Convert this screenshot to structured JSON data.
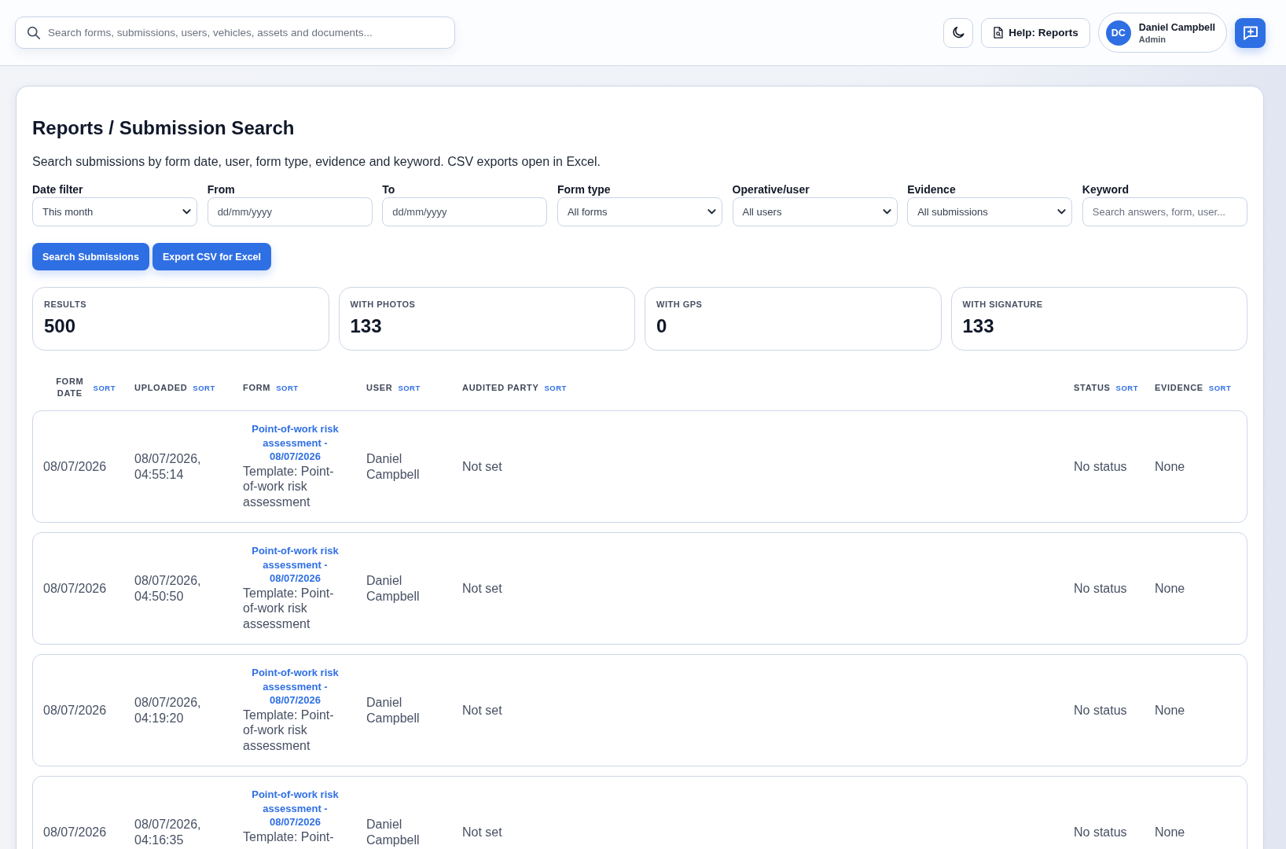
{
  "top_bar": {
    "search": {
      "placeholder": "Search forms, submissions, users, vehicles, assets and documents..."
    },
    "help_button": "Help: Reports",
    "user": {
      "initials": "DC",
      "name": "Daniel Campbell",
      "role": "Admin"
    }
  },
  "page": {
    "title": "Reports / Submission Search",
    "description": "Search submissions by form date, user, form type, evidence and keyword. CSV exports open in Excel."
  },
  "filters": [
    {
      "kind": "select",
      "label": "Date filter",
      "value": "This month"
    },
    {
      "kind": "date",
      "label": "From",
      "placeholder": "dd/mm/yyyy"
    },
    {
      "kind": "date",
      "label": "To",
      "placeholder": "dd/mm/yyyy"
    },
    {
      "kind": "select",
      "label": "Form type",
      "value": "All forms"
    },
    {
      "kind": "select",
      "label": "Operative/user",
      "value": "All users"
    },
    {
      "kind": "select",
      "label": "Evidence",
      "value": "All submissions"
    },
    {
      "kind": "text",
      "label": "Keyword",
      "placeholder": "Search answers, form, user..."
    }
  ],
  "actions": [
    "Search Submissions",
    "Export CSV for Excel"
  ],
  "stats": [
    {
      "label": "RESULTS",
      "value": "500"
    },
    {
      "label": "WITH PHOTOS",
      "value": "133"
    },
    {
      "label": "WITH GPS",
      "value": "0"
    },
    {
      "label": "WITH SIGNATURE",
      "value": "133"
    }
  ],
  "table": {
    "columns": [
      {
        "label": "FORM DATE",
        "sort": "SORT"
      },
      {
        "label": "UPLOADED",
        "sort": "SORT"
      },
      {
        "label": "FORM",
        "sort": "SORT"
      },
      {
        "label": "USER",
        "sort": "SORT"
      },
      {
        "label": "AUDITED PARTY",
        "sort": "SORT"
      },
      {
        "label": "STATUS",
        "sort": "SORT"
      },
      {
        "label": "EVIDENCE",
        "sort": "SORT"
      }
    ],
    "rows": [
      {
        "form_date": "08/07/2026",
        "uploaded": "08/07/2026, 04:55:14",
        "form": "Point-of-work risk assessment - 08/07/2026",
        "template": "Template: Point-of-work risk assessment",
        "user": "Daniel Campbell",
        "audited_party": "Not set",
        "status": "No status",
        "evidence": "None"
      },
      {
        "form_date": "08/07/2026",
        "uploaded": "08/07/2026, 04:50:50",
        "form": "Point-of-work risk assessment - 08/07/2026",
        "template": "Template: Point-of-work risk assessment",
        "user": "Daniel Campbell",
        "audited_party": "Not set",
        "status": "No status",
        "evidence": "None"
      },
      {
        "form_date": "08/07/2026",
        "uploaded": "08/07/2026, 04:19:20",
        "form": "Point-of-work risk assessment - 08/07/2026",
        "template": "Template: Point-of-work risk assessment",
        "user": "Daniel Campbell",
        "audited_party": "Not set",
        "status": "No status",
        "evidence": "None"
      },
      {
        "form_date": "08/07/2026",
        "uploaded": "08/07/2026, 04:16:35",
        "form": "Point-of-work risk assessment - 08/07/2026",
        "template": "Template: Point-",
        "user": "Daniel Campbell",
        "audited_party": "Not set",
        "status": "No status",
        "evidence": "None"
      }
    ]
  }
}
